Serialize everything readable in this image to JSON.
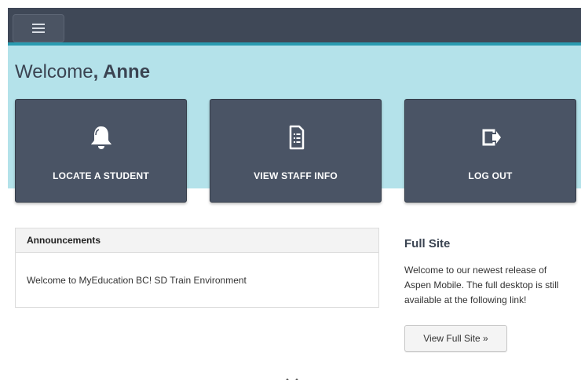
{
  "header": {
    "menu_icon": "hamburger-icon"
  },
  "welcome": {
    "greeting": "Welcome",
    "separator": ", ",
    "name": "Anne"
  },
  "tiles": [
    {
      "label": "LOCATE A STUDENT",
      "icon": "bell-icon"
    },
    {
      "label": "VIEW STAFF INFO",
      "icon": "document-icon"
    },
    {
      "label": "LOG OUT",
      "icon": "logout-icon"
    }
  ],
  "announcements": {
    "title": "Announcements",
    "message": "Welcome to MyEducation BC! SD Train Environment"
  },
  "full_site": {
    "title": "Full Site",
    "text": "Welcome to our newest release of Aspen Mobile. The full desktop is still available at the following link!",
    "button_label": "View Full Site »"
  },
  "colors": {
    "header_bg": "#3f4857",
    "accent": "#2a9bb0",
    "band_bg": "#b4e2ea",
    "tile_bg": "#4a5465"
  }
}
